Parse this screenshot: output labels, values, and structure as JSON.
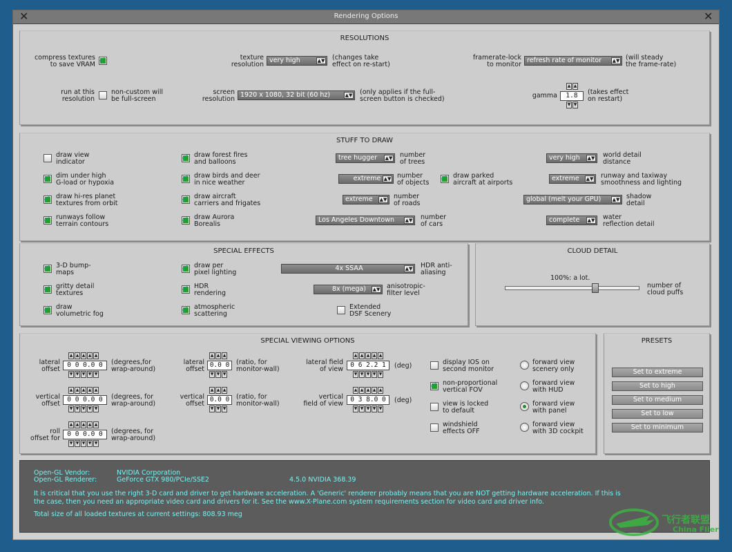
{
  "window": {
    "title": "Rendering Options"
  },
  "resolutions": {
    "title": "RESOLUTIONS",
    "compress_label": "compress textures\nto save VRAM",
    "texture_label": "texture\nresolution",
    "texture_value": "very high",
    "texture_note": "(changes take\neffect on re-start)",
    "framerate_label": "framerate-lock\nto monitor",
    "framerate_value": "refresh rate of monitor",
    "framerate_note": "(will steady\nthe frame-rate)",
    "run_label": "run at this\nresolution",
    "run_note": "non-custom will\nbe full-screen",
    "screen_label": "screen\nresolution",
    "screen_value": "1920 x 1080, 32 bit (60 hz)",
    "screen_note": "(only applies if the full-\nscreen button is checked)",
    "gamma_label": "gamma",
    "gamma_value": "1.8",
    "gamma_note": "(takes effect\non restart)"
  },
  "stuff": {
    "title": "STUFF TO DRAW",
    "col1": [
      {
        "label": "draw view\nindicator",
        "checked": false
      },
      {
        "label": "dim under high\nG-load or hypoxia",
        "checked": true
      },
      {
        "label": "draw hi-res planet\ntextures from orbit",
        "checked": true
      },
      {
        "label": "runways follow\nterrain contours",
        "checked": true
      }
    ],
    "col2": [
      {
        "label": "draw forest fires\nand balloons",
        "checked": true
      },
      {
        "label": "draw birds and deer\nin nice weather",
        "checked": true
      },
      {
        "label": "draw aircraft\ncarriers and frigates",
        "checked": true
      },
      {
        "label": "draw Aurora\nBorealis",
        "checked": true
      }
    ],
    "trees_value": "tree hugger",
    "trees_label": "number\nof trees",
    "objects_value": "extreme",
    "objects_label": "number\nof objects",
    "roads_value": "extreme",
    "roads_label": "number\nof roads",
    "cars_value": "Los Angeles Downtown",
    "cars_label": "number\nof cars",
    "parked_label": "draw parked\naircraft at airports",
    "world_value": "very high",
    "world_label": "world detail\ndistance",
    "runway_value": "extreme",
    "runway_label": "runway and taxiway\nsmoothness and lighting",
    "shadow_value": "global (melt your GPU)",
    "shadow_label": "shadow\ndetail",
    "water_value": "complete",
    "water_label": "water\nreflection detail"
  },
  "effects": {
    "title": "SPECIAL EFFECTS",
    "col1": [
      {
        "label": "3-D bump-\nmaps",
        "checked": true
      },
      {
        "label": "gritty detail\ntextures",
        "checked": true
      },
      {
        "label": "draw\nvolumetric fog",
        "checked": true
      }
    ],
    "col2": [
      {
        "label": "draw per\npixel lighting",
        "checked": true
      },
      {
        "label": "HDR\nrendering",
        "checked": true
      },
      {
        "label": "atmospheric\nscattering",
        "checked": true
      }
    ],
    "hdr_value": "4x SSAA",
    "hdr_label": "HDR anti-\naliasing",
    "aniso_value": "8x (mega)",
    "aniso_label": "anisotropic-\nfilter level",
    "dsf_label": "Extended\nDSF Scenery"
  },
  "cloud": {
    "title": "CLOUD DETAIL",
    "value_text": "100%: a lot.",
    "label": "number of\ncloud puffs",
    "level": 1.0
  },
  "viewing": {
    "title": "SPECIAL VIEWING OPTIONS",
    "lat_label": "lateral\noffset",
    "lat_value": "0 0 0.0 0",
    "lat_note": "(degrees,for\nwrap-around)",
    "vert_label": "vertical\noffset",
    "vert_value": "0 0 0.0 0",
    "vert_note": "(degrees, for\nwrap-around)",
    "roll_label": "roll\noffset for",
    "roll_value": "0 0 0.0 0",
    "roll_note": "(degrees, for\nwrap-around)",
    "lat2_label": "lateral\noffset",
    "lat2_value": "0.0 0",
    "lat2_note": "(ratio, for\nmonitor-wall)",
    "vert2_label": "vertical\noffset",
    "vert2_value": "0.0 0",
    "vert2_note": "(ratio, for\nmonitor-wall)",
    "latfov_label": "lateral field\nof view",
    "latfov_value": "0 6 2.2 1",
    "latfov_note": "(deg)",
    "vertfov_label": "vertical\nfield of view",
    "vertfov_value": "0 3 8.0 0",
    "vertfov_note": "(deg)",
    "checks": [
      {
        "label": "display IOS on\nsecond monitor",
        "checked": false
      },
      {
        "label": "non-proportional\nvertical FOV",
        "checked": true
      },
      {
        "label": "view is locked\nto default",
        "checked": false
      },
      {
        "label": "windshield\neffects OFF",
        "checked": false
      }
    ],
    "radios": [
      {
        "label": "forward view\nscenery only",
        "on": false
      },
      {
        "label": "forward view\nwith HUD",
        "on": false
      },
      {
        "label": "forward view\nwith panel",
        "on": true
      },
      {
        "label": "forward view\nwith 3D cockpit",
        "on": false
      }
    ]
  },
  "presets": {
    "title": "PRESETS",
    "buttons": [
      "Set to extreme",
      "Set to high",
      "Set to medium",
      "Set to low",
      "Set to minimum"
    ]
  },
  "info": {
    "vendor_label": "Open-GL Vendor:",
    "vendor": "NVIDIA Corporation",
    "renderer_label": "Open-GL Renderer:",
    "renderer": "GeForce GTX 980/PCIe/SSE2",
    "version": "4.5.0 NVIDIA 368.39",
    "warning": "It is critical that you use the right 3-D card and driver to get hardware acceleration. A 'Generic' renderer probably means that you are NOT getting hardware acceleration. If this is\nthe case, then you need an appropriate video card and drivers for it. See the www.X-Plane.com system requirements section for video card and driver info.",
    "total": "Total size of all loaded textures at current settings: 808.93 meg"
  },
  "watermark": {
    "cn": "飞行者联盟",
    "en": "China Flier"
  },
  "colors": {
    "accent_check": "#2e9a2e",
    "info_text": "#7ef0f0",
    "background": "#1e5d8c"
  }
}
